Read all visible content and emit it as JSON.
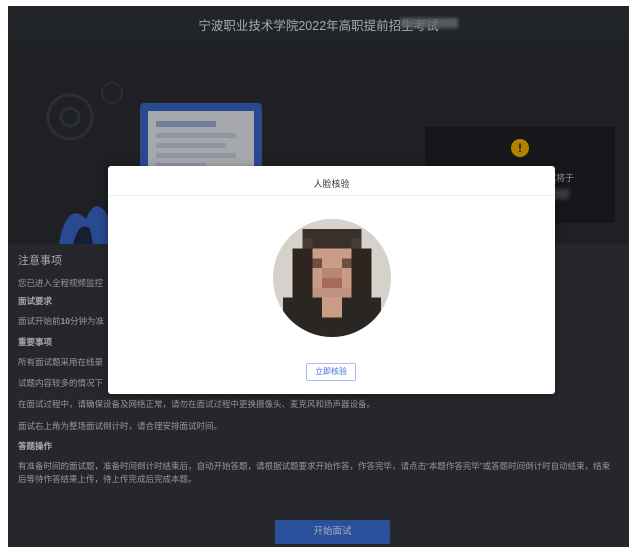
{
  "window": {
    "title": "宁波职业技术学院2022年高职提前招生考试"
  },
  "notice_card": {
    "icon": "exclamation-icon",
    "text": "请尽快进入面试，面试将于"
  },
  "instructions": {
    "heading": "注意事项",
    "intro": "您已进入全程视频监控",
    "section1_title": "面试要求",
    "section1_line1_pre": "面试开始前",
    "section1_line1_bold": "10",
    "section1_line1_post": "分钟为准",
    "section2_title": "重要事项",
    "line_a": "所有面试题采用在线录",
    "line_b": "试题内容较多的情况下",
    "line_c": "在面试过程中，请确保设备及网络正常，请勿在面试过程中更换摄像头、麦克风和扬声器设备。",
    "line_d": "面试右上角为整场面试倒计时，请合理安排面试时间。",
    "section3_title": "答题操作",
    "para": "有准备时间的面试题，准备时间倒计时结束后，自动开始答题，请根据试题要求开始作答，作答完毕，请点击“本题作答完毕”或答题时间倒计时自动结束，结束后等待作答结果上传，待上传完成后完成本题。",
    "start_button": "开始面试"
  },
  "modal": {
    "title": "人脸核验",
    "verify_button": "立即核验"
  },
  "colors": {
    "accent": "#3b6fd9",
    "warning": "#f5b400",
    "page_dark": "#2b2f36"
  }
}
